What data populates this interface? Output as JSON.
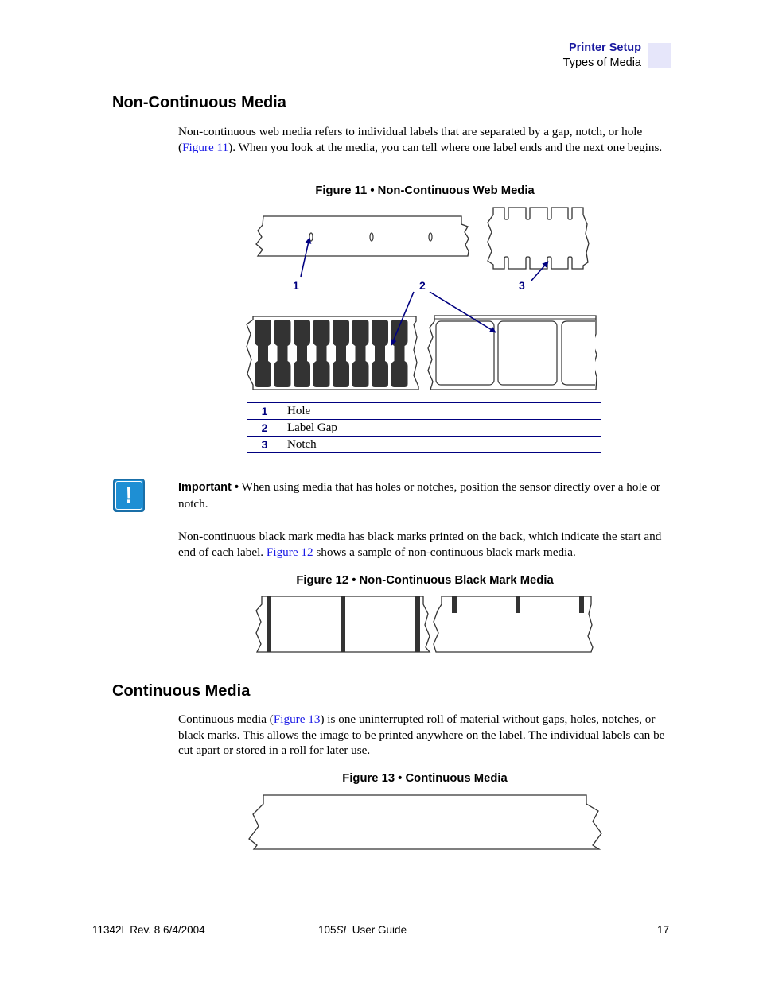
{
  "header": {
    "section": "Printer Setup",
    "subsection": "Types of Media"
  },
  "non_continuous": {
    "heading": "Non-Continuous Media",
    "intro": {
      "before_link": "Non-continuous web media refers to individual labels that are separated by a gap, notch, or hole (",
      "link": "Figure 11",
      "after_link": "). When you look at the media, you can tell where one label ends and the next one begins."
    },
    "figure11": {
      "caption": "Figure 11 • Non-Continuous Web Media",
      "callouts": [
        "1",
        "2",
        "3"
      ],
      "legend": [
        {
          "num": "1",
          "label": "Hole"
        },
        {
          "num": "2",
          "label": "Label Gap"
        },
        {
          "num": "3",
          "label": "Notch"
        }
      ]
    },
    "important": {
      "icon": "exclamation-icon",
      "label": "Important •",
      "text": " When using media that has holes or notches, position the sensor directly over a hole or notch."
    },
    "black_mark": {
      "before_link": "Non-continuous black mark media has black marks printed on the back, which indicate the start and end of each label. ",
      "link": "Figure 12",
      "after_link": " shows a sample of non-continuous black mark media."
    },
    "figure12": {
      "caption": "Figure 12 • Non-Continuous Black Mark Media"
    }
  },
  "continuous": {
    "heading": "Continuous Media",
    "intro": {
      "before_link": "Continuous media (",
      "link": "Figure 13",
      "after_link": ") is one uninterrupted roll of material without gaps, holes, notches, or black marks. This allows the image to be printed anywhere on the label. The individual labels can be cut apart or stored in a roll for later use."
    },
    "figure13": {
      "caption": "Figure 13 • Continuous Media"
    }
  },
  "footer": {
    "doc_id": "11342L Rev. 8   6/4/2004",
    "title_model": "105",
    "title_model_italic": "SL",
    "title_rest": " User Guide",
    "page": "17"
  },
  "colors": {
    "callout_blue": "#000080",
    "link_blue": "#1a1ae6",
    "header_blue": "#1a1aa0",
    "important_blue": "#1e8fd4",
    "label_dark": "#333333"
  }
}
